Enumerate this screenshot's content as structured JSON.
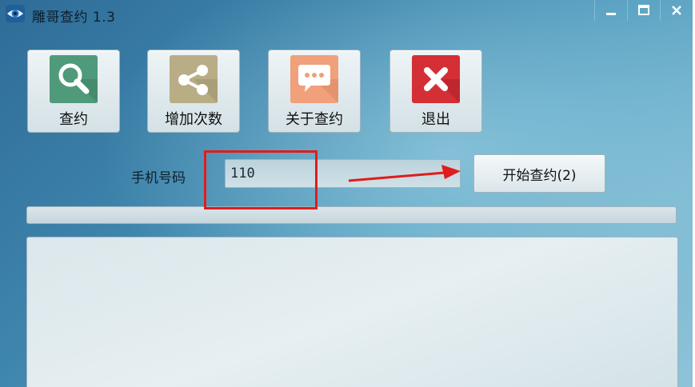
{
  "window": {
    "title": "雕哥查约 1.3",
    "icons": {
      "app": "eye-logo-icon",
      "minimize": "minimize-icon",
      "maximize": "maximize-icon",
      "close": "close-icon"
    }
  },
  "toolbar": {
    "buttons": [
      {
        "label": "查约",
        "icon": "search-icon",
        "tile_color": "#4f9a7a"
      },
      {
        "label": "增加次数",
        "icon": "share-icon",
        "tile_color": "#b9ad86"
      },
      {
        "label": "关于查约",
        "icon": "chat-bubble-icon",
        "tile_color": "#f0a07a"
      },
      {
        "label": "退出",
        "icon": "close-x-icon",
        "tile_color": "#d32f35"
      }
    ]
  },
  "form": {
    "phone_label": "手机号码",
    "phone_value": "110",
    "start_button_label": "开始查约(2)"
  },
  "progress": {
    "value_percent": 0
  },
  "results": {
    "text": ""
  },
  "annotations": {
    "box_color": "#e01c1c",
    "arrow_color": "#e01c1c"
  }
}
